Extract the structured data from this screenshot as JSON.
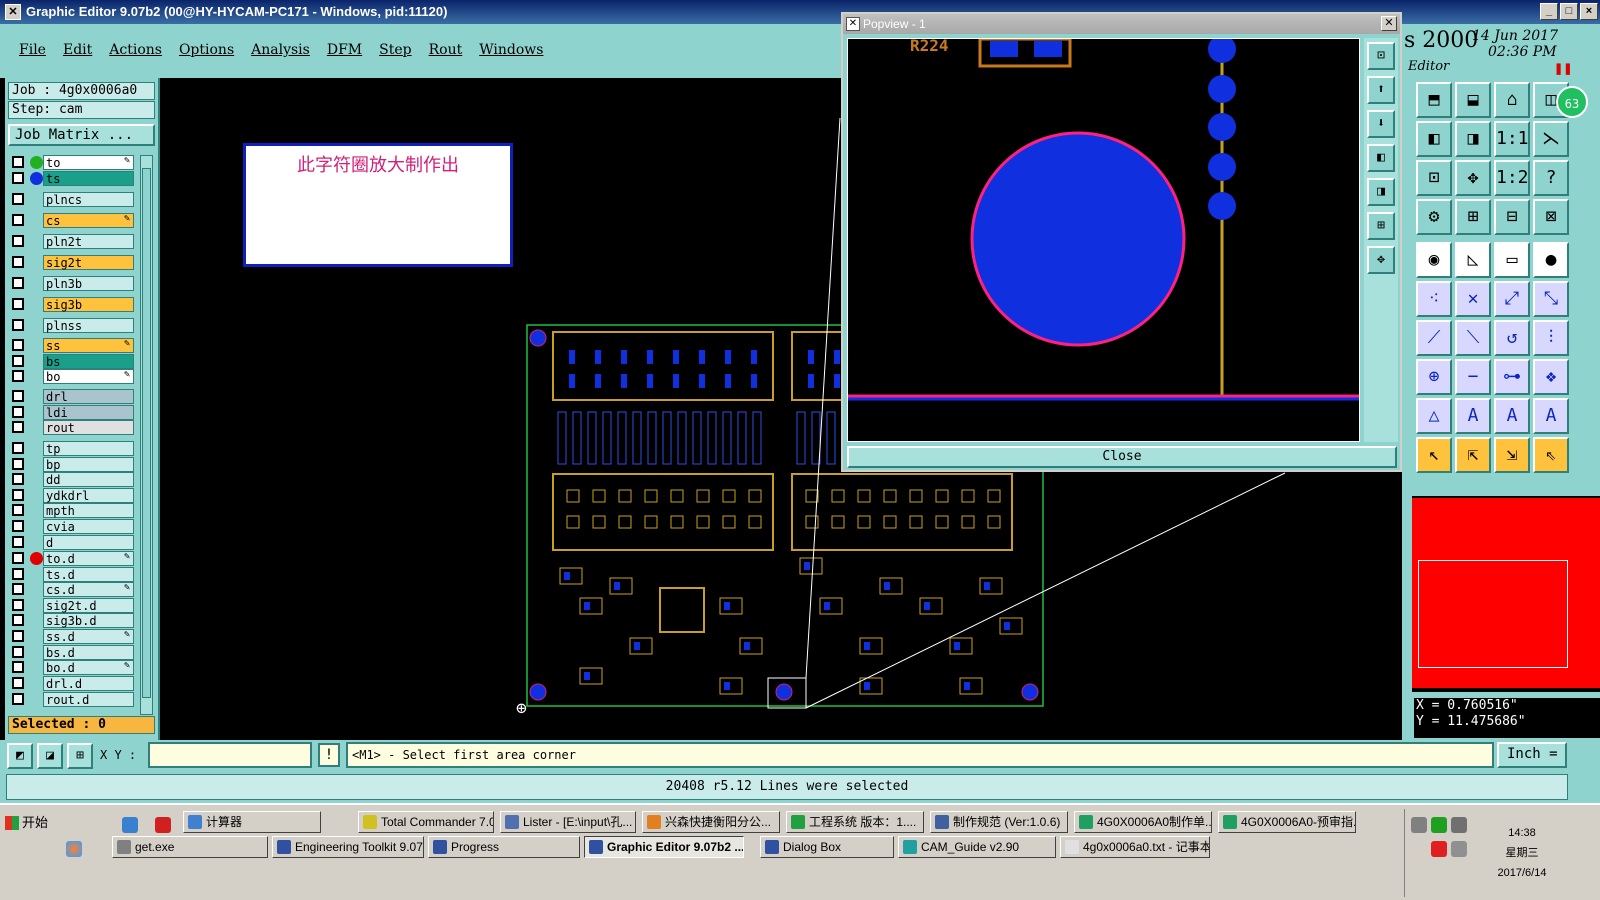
{
  "window": {
    "title": "Graphic Editor 9.07b2 (00@HY-HYCAM-PC171 - Windows, pid:11120)",
    "controls": [
      "_",
      "□",
      "×"
    ]
  },
  "menu": [
    "File",
    "Edit",
    "Actions",
    "Options",
    "Analysis",
    "DFM",
    "Step",
    "Rout",
    "Windows"
  ],
  "left": {
    "job": "Job : 4g0x0006a0",
    "step": "Step: cam",
    "job_matrix": "Job Matrix ...",
    "selected": "Selected : 0"
  },
  "layers": [
    {
      "name": "to",
      "bg": "#ffffff",
      "dot": "#20b020",
      "edit": true
    },
    {
      "name": "ts",
      "bg": "#1aa08a",
      "dot": "#1030e0",
      "edit": false
    },
    {
      "name": "plncs",
      "bg": "#c9ecea",
      "dot": "",
      "edit": false
    },
    {
      "name": "cs",
      "bg": "#ffc23d",
      "dot": "",
      "edit": true
    },
    {
      "name": "pln2t",
      "bg": "#c9ecea",
      "dot": "",
      "edit": false
    },
    {
      "name": "sig2t",
      "bg": "#ffc23d",
      "dot": "",
      "edit": false
    },
    {
      "name": "pln3b",
      "bg": "#c9ecea",
      "dot": "",
      "edit": false
    },
    {
      "name": "sig3b",
      "bg": "#ffc23d",
      "dot": "",
      "edit": false
    },
    {
      "name": "plnss",
      "bg": "#c9ecea",
      "dot": "",
      "edit": false
    },
    {
      "name": "ss",
      "bg": "#ffc23d",
      "dot": "",
      "edit": true
    },
    {
      "name": "bs",
      "bg": "#1aa08a",
      "dot": "",
      "edit": false
    },
    {
      "name": "bo",
      "bg": "#ffffff",
      "dot": "",
      "edit": true
    },
    {
      "name": "drl",
      "bg": "#a9c4cc",
      "dot": "",
      "edit": false
    },
    {
      "name": "ldi",
      "bg": "#a9c4cc",
      "dot": "",
      "edit": false
    },
    {
      "name": "rout",
      "bg": "#e0e0e0",
      "dot": "",
      "edit": false
    },
    {
      "name": "tp",
      "bg": "#c9ecea",
      "dot": "",
      "edit": false
    },
    {
      "name": "bp",
      "bg": "#c9ecea",
      "dot": "",
      "edit": false
    },
    {
      "name": "dd",
      "bg": "#c9ecea",
      "dot": "",
      "edit": false
    },
    {
      "name": "ydkdrl",
      "bg": "#c9ecea",
      "dot": "",
      "edit": false
    },
    {
      "name": "mpth",
      "bg": "#c9ecea",
      "dot": "",
      "edit": false
    },
    {
      "name": "cvia",
      "bg": "#c9ecea",
      "dot": "",
      "edit": false
    },
    {
      "name": "d",
      "bg": "#c9ecea",
      "dot": "",
      "edit": false
    },
    {
      "name": "to.d",
      "bg": "#c9ecea",
      "dot": "#e00000",
      "edit": true
    },
    {
      "name": "ts.d",
      "bg": "#c9ecea",
      "dot": "",
      "edit": false
    },
    {
      "name": "cs.d",
      "bg": "#c9ecea",
      "dot": "",
      "edit": true
    },
    {
      "name": "sig2t.d",
      "bg": "#c9ecea",
      "dot": "",
      "edit": false
    },
    {
      "name": "sig3b.d",
      "bg": "#c9ecea",
      "dot": "",
      "edit": false
    },
    {
      "name": "ss.d",
      "bg": "#c9ecea",
      "dot": "",
      "edit": true
    },
    {
      "name": "bs.d",
      "bg": "#c9ecea",
      "dot": "",
      "edit": false
    },
    {
      "name": "bo.d",
      "bg": "#c9ecea",
      "dot": "",
      "edit": true
    },
    {
      "name": "drl.d",
      "bg": "#c9ecea",
      "dot": "",
      "edit": false
    },
    {
      "name": "rout.d",
      "bg": "#c9ecea",
      "dot": "",
      "edit": false
    }
  ],
  "canvas": {
    "note": "此字符圈放大制作出",
    "board_label": "R224"
  },
  "popview": {
    "title": "Popview - 1",
    "close": "Close",
    "side_icons": [
      "zoom-fit-icon",
      "zoom-in-icon",
      "zoom-out-icon",
      "pan-left-icon",
      "pan-right-icon",
      "zoom-box-icon",
      "center-icon"
    ]
  },
  "right": {
    "product": "s 2000",
    "date": "14 Jun 2017",
    "time": "02:36 PM",
    "mode": "Editor",
    "coord_x": "X =  0.760516\"",
    "coord_y": "Y = 11.475686\"",
    "badge": "63"
  },
  "cmd": {
    "xy_label": "X Y :",
    "xy_value": "",
    "bang": "!",
    "prompt": "<M1> - Select first area corner",
    "unit": "Inch ="
  },
  "status": "20408 r5.12 Lines were selected",
  "taskbar": {
    "start": "开始",
    "row1": [
      "计算器",
      "Total Commander 7.0...",
      "Lister - [E:\\input\\孔...",
      "兴森快捷衡阳分公...",
      "工程系统  版本：1....",
      "制作规范 (Ver:1.0.6)",
      "4G0X0006A0制作单....",
      "4G0X0006A0-预审指..."
    ],
    "row2": [
      "get.exe",
      "Engineering Toolkit 9.07...",
      "Progress",
      "Graphic Editor 9.07b2 ...",
      "Dialog Box",
      "CAM_Guide v2.90",
      "4g0x0006a0.txt - 记事本"
    ],
    "time": "14:38",
    "weekday": "星期三",
    "date": "2017/6/14"
  }
}
